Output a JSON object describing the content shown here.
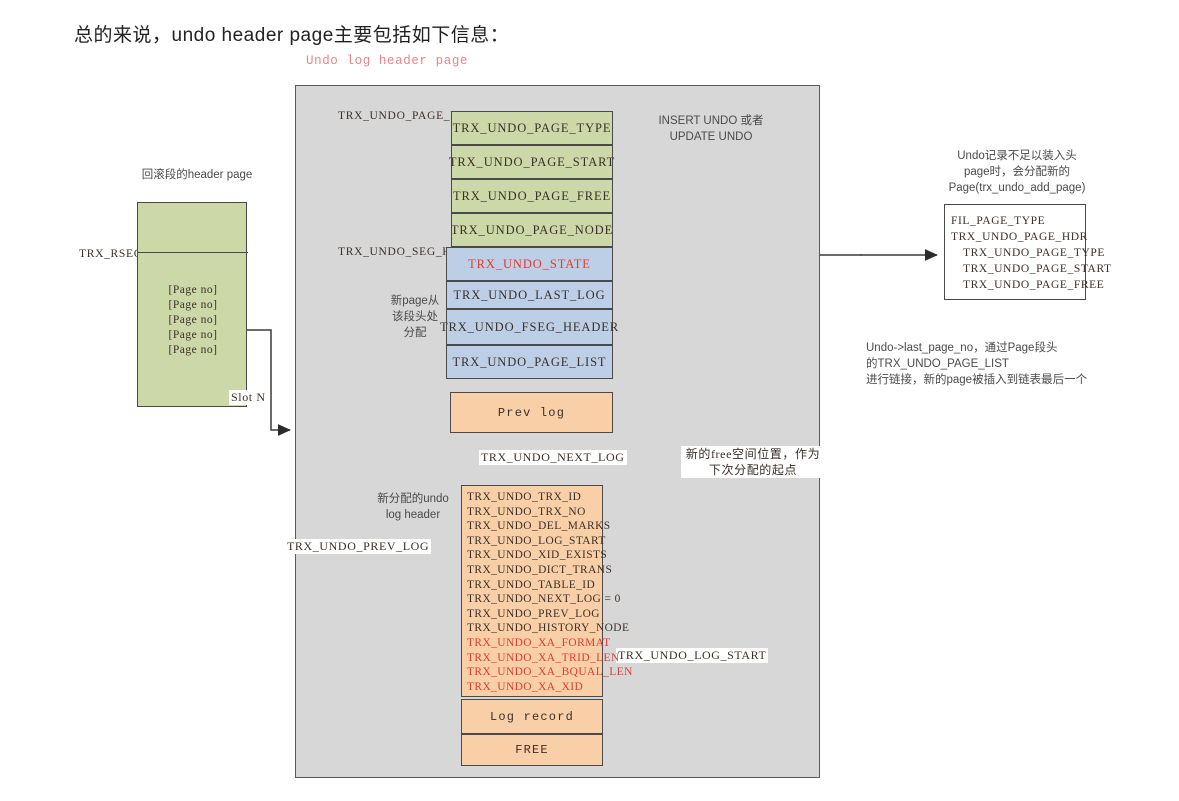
{
  "page": {
    "title": "总的来说，undo header page主要包括如下信息：",
    "diagram_caption": "Undo log header page"
  },
  "colors": {
    "page_hdr_green": "#ccd8a7",
    "seg_hdr_blue": "#bdcfe6",
    "log_peach": "#f9cfa8",
    "panel_gray": "#d7d7d7",
    "highlight_red": "#e03a32",
    "caption_pink": "#e8848a"
  },
  "rollback_segment": {
    "title": "回滚段的header page",
    "side_label": "TRX_RSEG",
    "page_entries": [
      "[Page no]",
      "[Page no]",
      "[Page no]",
      "[Page no]",
      "[Page no]"
    ],
    "slot_label": "Slot N"
  },
  "undo_page": {
    "page_hdr_label": "TRX_UNDO_PAGE_HDR",
    "seg_hdr_label": "TRX_UNDO_SEG_HDR",
    "page_hdr_fields": [
      "TRX_UNDO_PAGE_TYPE",
      "TRX_UNDO_PAGE_START",
      "TRX_UNDO_PAGE_FREE",
      "TRX_UNDO_PAGE_NODE"
    ],
    "seg_hdr_fields": [
      {
        "name": "TRX_UNDO_STATE",
        "highlight": true
      },
      {
        "name": "TRX_UNDO_LAST_LOG",
        "highlight": false
      },
      {
        "name": "TRX_UNDO_FSEG_HEADER",
        "highlight": false
      },
      {
        "name": "TRX_UNDO_PAGE_LIST",
        "highlight": false
      }
    ],
    "undo_type_note": "INSERT UNDO 或者\nUPDATE UNDO",
    "new_page_alloc_note": "新page从\n该段头处\n分配",
    "prev_log_box": "Prev log",
    "new_log_header_note": "新分配的undo\nlog header",
    "log_record_box": "Log record",
    "free_box": "FREE"
  },
  "undo_log_header_fields": [
    {
      "name": "TRX_UNDO_TRX_ID",
      "xa": false
    },
    {
      "name": "TRX_UNDO_TRX_NO",
      "xa": false
    },
    {
      "name": "TRX_UNDO_DEL_MARKS",
      "xa": false
    },
    {
      "name": "TRX_UNDO_LOG_START",
      "xa": false
    },
    {
      "name": "TRX_UNDO_XID_EXISTS",
      "xa": false
    },
    {
      "name": "TRX_UNDO_DICT_TRANS",
      "xa": false
    },
    {
      "name": "TRX_UNDO_TABLE_ID",
      "xa": false
    },
    {
      "name": "TRX_UNDO_NEXT_LOG = 0",
      "xa": false
    },
    {
      "name": "TRX_UNDO_PREV_LOG",
      "xa": false
    },
    {
      "name": "TRX_UNDO_HISTORY_NODE",
      "xa": false
    },
    {
      "name": "TRX_UNDO_XA_FORMAT",
      "xa": true
    },
    {
      "name": "TRX_UNDO_XA_TRID_LEN",
      "xa": true
    },
    {
      "name": "TRX_UNDO_XA_BQUAL_LEN",
      "xa": true
    },
    {
      "name": "TRX_UNDO_XA_XID",
      "xa": true
    }
  ],
  "edge_labels": {
    "next_log": "TRX_UNDO_NEXT_LOG",
    "prev_log": "TRX_UNDO_PREV_LOG",
    "log_start": "TRX_UNDO_LOG_START",
    "free_space": "新的free空间位置，作为\n下次分配的起点"
  },
  "new_page_box": {
    "note": "Undo记录不足以装入头\npage时，会分配新的\nPage(trx_undo_add_page)",
    "fields": [
      {
        "name": "FIL_PAGE_TYPE",
        "indent": false
      },
      {
        "name": "TRX_UNDO_PAGE_HDR",
        "indent": false
      },
      {
        "name": "TRX_UNDO_PAGE_TYPE",
        "indent": true
      },
      {
        "name": "TRX_UNDO_PAGE_START",
        "indent": true
      },
      {
        "name": "TRX_UNDO_PAGE_FREE",
        "indent": true
      }
    ],
    "link_note": "Undo->last_page_no，通过Page段头\n的TRX_UNDO_PAGE_LIST\n进行链接，新的page被插入到链表最后一个"
  }
}
